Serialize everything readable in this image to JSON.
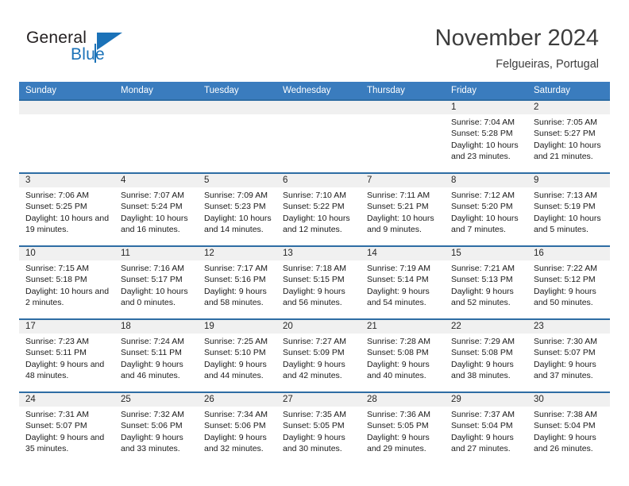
{
  "brand": {
    "name_part1": "General",
    "name_part2": "Blue",
    "flag_icon": "triangle-flag-icon"
  },
  "header": {
    "month_title": "November 2024",
    "location": "Felgueiras, Portugal"
  },
  "calendar": {
    "weekday_headers": [
      "Sunday",
      "Monday",
      "Tuesday",
      "Wednesday",
      "Thursday",
      "Friday",
      "Saturday"
    ],
    "header_bg_color": "#3a7cbe",
    "row_border_color": "#2e6da4",
    "daynum_bg_color": "#f0f0f0",
    "weeks": [
      [
        {
          "day": "",
          "sunrise": "",
          "sunset": "",
          "daylight": ""
        },
        {
          "day": "",
          "sunrise": "",
          "sunset": "",
          "daylight": ""
        },
        {
          "day": "",
          "sunrise": "",
          "sunset": "",
          "daylight": ""
        },
        {
          "day": "",
          "sunrise": "",
          "sunset": "",
          "daylight": ""
        },
        {
          "day": "",
          "sunrise": "",
          "sunset": "",
          "daylight": ""
        },
        {
          "day": "1",
          "sunrise": "Sunrise: 7:04 AM",
          "sunset": "Sunset: 5:28 PM",
          "daylight": "Daylight: 10 hours and 23 minutes."
        },
        {
          "day": "2",
          "sunrise": "Sunrise: 7:05 AM",
          "sunset": "Sunset: 5:27 PM",
          "daylight": "Daylight: 10 hours and 21 minutes."
        }
      ],
      [
        {
          "day": "3",
          "sunrise": "Sunrise: 7:06 AM",
          "sunset": "Sunset: 5:25 PM",
          "daylight": "Daylight: 10 hours and 19 minutes."
        },
        {
          "day": "4",
          "sunrise": "Sunrise: 7:07 AM",
          "sunset": "Sunset: 5:24 PM",
          "daylight": "Daylight: 10 hours and 16 minutes."
        },
        {
          "day": "5",
          "sunrise": "Sunrise: 7:09 AM",
          "sunset": "Sunset: 5:23 PM",
          "daylight": "Daylight: 10 hours and 14 minutes."
        },
        {
          "day": "6",
          "sunrise": "Sunrise: 7:10 AM",
          "sunset": "Sunset: 5:22 PM",
          "daylight": "Daylight: 10 hours and 12 minutes."
        },
        {
          "day": "7",
          "sunrise": "Sunrise: 7:11 AM",
          "sunset": "Sunset: 5:21 PM",
          "daylight": "Daylight: 10 hours and 9 minutes."
        },
        {
          "day": "8",
          "sunrise": "Sunrise: 7:12 AM",
          "sunset": "Sunset: 5:20 PM",
          "daylight": "Daylight: 10 hours and 7 minutes."
        },
        {
          "day": "9",
          "sunrise": "Sunrise: 7:13 AM",
          "sunset": "Sunset: 5:19 PM",
          "daylight": "Daylight: 10 hours and 5 minutes."
        }
      ],
      [
        {
          "day": "10",
          "sunrise": "Sunrise: 7:15 AM",
          "sunset": "Sunset: 5:18 PM",
          "daylight": "Daylight: 10 hours and 2 minutes."
        },
        {
          "day": "11",
          "sunrise": "Sunrise: 7:16 AM",
          "sunset": "Sunset: 5:17 PM",
          "daylight": "Daylight: 10 hours and 0 minutes."
        },
        {
          "day": "12",
          "sunrise": "Sunrise: 7:17 AM",
          "sunset": "Sunset: 5:16 PM",
          "daylight": "Daylight: 9 hours and 58 minutes."
        },
        {
          "day": "13",
          "sunrise": "Sunrise: 7:18 AM",
          "sunset": "Sunset: 5:15 PM",
          "daylight": "Daylight: 9 hours and 56 minutes."
        },
        {
          "day": "14",
          "sunrise": "Sunrise: 7:19 AM",
          "sunset": "Sunset: 5:14 PM",
          "daylight": "Daylight: 9 hours and 54 minutes."
        },
        {
          "day": "15",
          "sunrise": "Sunrise: 7:21 AM",
          "sunset": "Sunset: 5:13 PM",
          "daylight": "Daylight: 9 hours and 52 minutes."
        },
        {
          "day": "16",
          "sunrise": "Sunrise: 7:22 AM",
          "sunset": "Sunset: 5:12 PM",
          "daylight": "Daylight: 9 hours and 50 minutes."
        }
      ],
      [
        {
          "day": "17",
          "sunrise": "Sunrise: 7:23 AM",
          "sunset": "Sunset: 5:11 PM",
          "daylight": "Daylight: 9 hours and 48 minutes."
        },
        {
          "day": "18",
          "sunrise": "Sunrise: 7:24 AM",
          "sunset": "Sunset: 5:11 PM",
          "daylight": "Daylight: 9 hours and 46 minutes."
        },
        {
          "day": "19",
          "sunrise": "Sunrise: 7:25 AM",
          "sunset": "Sunset: 5:10 PM",
          "daylight": "Daylight: 9 hours and 44 minutes."
        },
        {
          "day": "20",
          "sunrise": "Sunrise: 7:27 AM",
          "sunset": "Sunset: 5:09 PM",
          "daylight": "Daylight: 9 hours and 42 minutes."
        },
        {
          "day": "21",
          "sunrise": "Sunrise: 7:28 AM",
          "sunset": "Sunset: 5:08 PM",
          "daylight": "Daylight: 9 hours and 40 minutes."
        },
        {
          "day": "22",
          "sunrise": "Sunrise: 7:29 AM",
          "sunset": "Sunset: 5:08 PM",
          "daylight": "Daylight: 9 hours and 38 minutes."
        },
        {
          "day": "23",
          "sunrise": "Sunrise: 7:30 AM",
          "sunset": "Sunset: 5:07 PM",
          "daylight": "Daylight: 9 hours and 37 minutes."
        }
      ],
      [
        {
          "day": "24",
          "sunrise": "Sunrise: 7:31 AM",
          "sunset": "Sunset: 5:07 PM",
          "daylight": "Daylight: 9 hours and 35 minutes."
        },
        {
          "day": "25",
          "sunrise": "Sunrise: 7:32 AM",
          "sunset": "Sunset: 5:06 PM",
          "daylight": "Daylight: 9 hours and 33 minutes."
        },
        {
          "day": "26",
          "sunrise": "Sunrise: 7:34 AM",
          "sunset": "Sunset: 5:06 PM",
          "daylight": "Daylight: 9 hours and 32 minutes."
        },
        {
          "day": "27",
          "sunrise": "Sunrise: 7:35 AM",
          "sunset": "Sunset: 5:05 PM",
          "daylight": "Daylight: 9 hours and 30 minutes."
        },
        {
          "day": "28",
          "sunrise": "Sunrise: 7:36 AM",
          "sunset": "Sunset: 5:05 PM",
          "daylight": "Daylight: 9 hours and 29 minutes."
        },
        {
          "day": "29",
          "sunrise": "Sunrise: 7:37 AM",
          "sunset": "Sunset: 5:04 PM",
          "daylight": "Daylight: 9 hours and 27 minutes."
        },
        {
          "day": "30",
          "sunrise": "Sunrise: 7:38 AM",
          "sunset": "Sunset: 5:04 PM",
          "daylight": "Daylight: 9 hours and 26 minutes."
        }
      ]
    ]
  }
}
